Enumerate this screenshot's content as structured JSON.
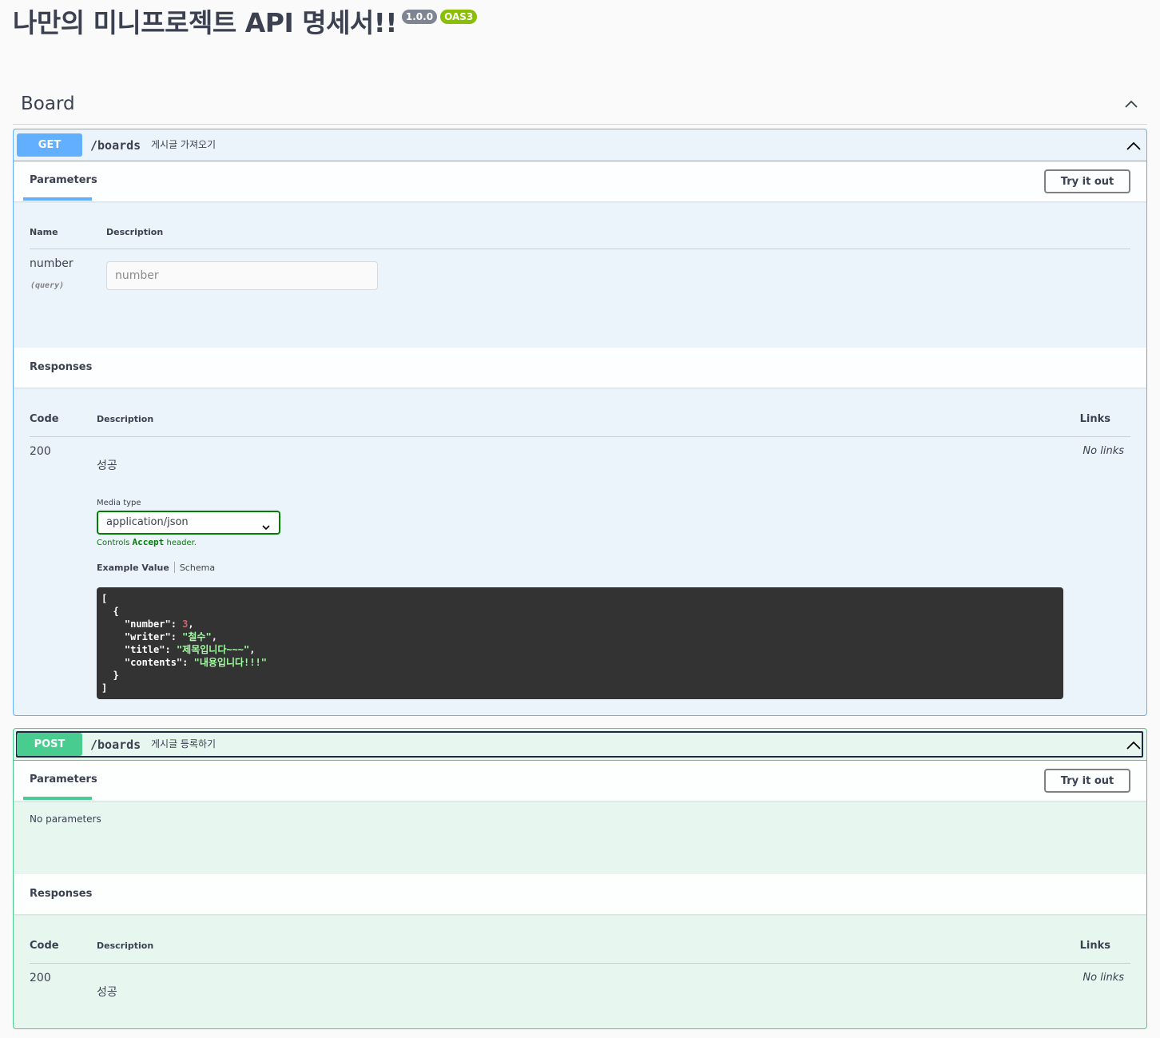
{
  "header": {
    "title": "나만의 미니프로젝트 API 명세서!!",
    "version_badge": "1.0.0",
    "oas_badge": "OAS3"
  },
  "tag": {
    "name": "Board"
  },
  "get_op": {
    "method": "GET",
    "path": "/boards",
    "summary": "게시글 가져오기",
    "params_tab": "Parameters",
    "try_label": "Try it out",
    "col_name": "Name",
    "col_description": "Description",
    "param": {
      "name": "number",
      "in": "(query)",
      "placeholder": "number"
    },
    "responses_title": "Responses",
    "resp_col_code": "Code",
    "resp_col_description": "Description",
    "resp_col_links": "Links",
    "response": {
      "code": "200",
      "description": "성공",
      "links": "No links",
      "media_type_label": "Media type",
      "media_type": "application/json",
      "controls_prefix": "Controls",
      "controls_code": "Accept",
      "controls_suffix": "header.",
      "example_tab": "Example Value",
      "schema_tab": "Schema",
      "example": {
        "bracket_open": "[",
        "brace_open": "{",
        "k_number": "\"number\"",
        "v_number": "3",
        "k_writer": "\"writer\"",
        "v_writer": "\"철수\"",
        "k_title": "\"title\"",
        "v_title": "\"제목입니다~~~\"",
        "k_contents": "\"contents\"",
        "v_contents": "\"내용입니다!!!\"",
        "brace_close": "}",
        "bracket_close": "]"
      }
    }
  },
  "post_op": {
    "method": "POST",
    "path": "/boards",
    "summary": "게시글 등록하기",
    "params_tab": "Parameters",
    "try_label": "Try it out",
    "no_params": "No parameters",
    "responses_title": "Responses",
    "resp_col_code": "Code",
    "resp_col_description": "Description",
    "resp_col_links": "Links",
    "response": {
      "code": "200",
      "description": "성공",
      "links": "No links"
    }
  },
  "colors": {
    "get": "#61affe",
    "post": "#49cc90",
    "get_bg": "#ebf3fb",
    "post_bg": "#e8f6f0"
  },
  "icons": [
    "chevron-up-icon",
    "chevron-down-icon"
  ]
}
